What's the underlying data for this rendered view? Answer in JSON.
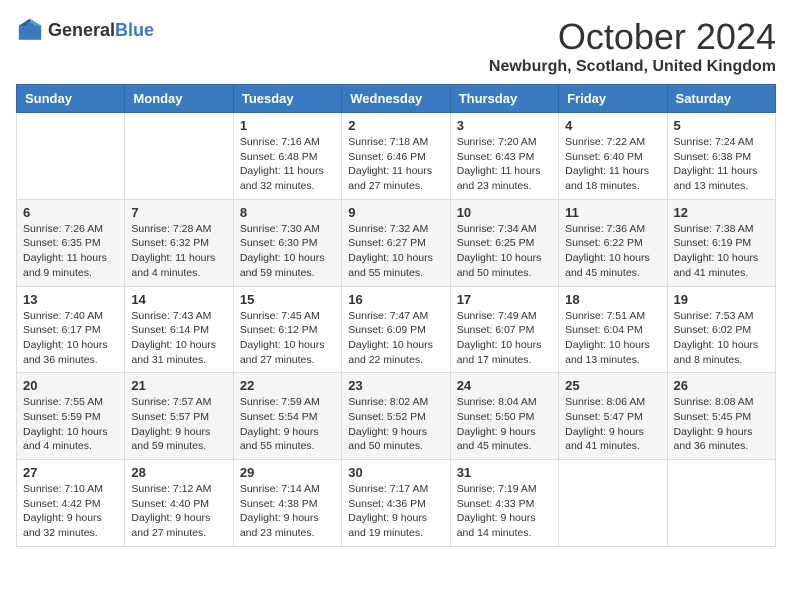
{
  "logo": {
    "text_general": "General",
    "text_blue": "Blue"
  },
  "header": {
    "month": "October 2024",
    "location": "Newburgh, Scotland, United Kingdom"
  },
  "days_of_week": [
    "Sunday",
    "Monday",
    "Tuesday",
    "Wednesday",
    "Thursday",
    "Friday",
    "Saturday"
  ],
  "weeks": [
    [
      {
        "day": "",
        "info": ""
      },
      {
        "day": "",
        "info": ""
      },
      {
        "day": "1",
        "info": "Sunrise: 7:16 AM\nSunset: 6:48 PM\nDaylight: 11 hours and 32 minutes."
      },
      {
        "day": "2",
        "info": "Sunrise: 7:18 AM\nSunset: 6:46 PM\nDaylight: 11 hours and 27 minutes."
      },
      {
        "day": "3",
        "info": "Sunrise: 7:20 AM\nSunset: 6:43 PM\nDaylight: 11 hours and 23 minutes."
      },
      {
        "day": "4",
        "info": "Sunrise: 7:22 AM\nSunset: 6:40 PM\nDaylight: 11 hours and 18 minutes."
      },
      {
        "day": "5",
        "info": "Sunrise: 7:24 AM\nSunset: 6:38 PM\nDaylight: 11 hours and 13 minutes."
      }
    ],
    [
      {
        "day": "6",
        "info": "Sunrise: 7:26 AM\nSunset: 6:35 PM\nDaylight: 11 hours and 9 minutes."
      },
      {
        "day": "7",
        "info": "Sunrise: 7:28 AM\nSunset: 6:32 PM\nDaylight: 11 hours and 4 minutes."
      },
      {
        "day": "8",
        "info": "Sunrise: 7:30 AM\nSunset: 6:30 PM\nDaylight: 10 hours and 59 minutes."
      },
      {
        "day": "9",
        "info": "Sunrise: 7:32 AM\nSunset: 6:27 PM\nDaylight: 10 hours and 55 minutes."
      },
      {
        "day": "10",
        "info": "Sunrise: 7:34 AM\nSunset: 6:25 PM\nDaylight: 10 hours and 50 minutes."
      },
      {
        "day": "11",
        "info": "Sunrise: 7:36 AM\nSunset: 6:22 PM\nDaylight: 10 hours and 45 minutes."
      },
      {
        "day": "12",
        "info": "Sunrise: 7:38 AM\nSunset: 6:19 PM\nDaylight: 10 hours and 41 minutes."
      }
    ],
    [
      {
        "day": "13",
        "info": "Sunrise: 7:40 AM\nSunset: 6:17 PM\nDaylight: 10 hours and 36 minutes."
      },
      {
        "day": "14",
        "info": "Sunrise: 7:43 AM\nSunset: 6:14 PM\nDaylight: 10 hours and 31 minutes."
      },
      {
        "day": "15",
        "info": "Sunrise: 7:45 AM\nSunset: 6:12 PM\nDaylight: 10 hours and 27 minutes."
      },
      {
        "day": "16",
        "info": "Sunrise: 7:47 AM\nSunset: 6:09 PM\nDaylight: 10 hours and 22 minutes."
      },
      {
        "day": "17",
        "info": "Sunrise: 7:49 AM\nSunset: 6:07 PM\nDaylight: 10 hours and 17 minutes."
      },
      {
        "day": "18",
        "info": "Sunrise: 7:51 AM\nSunset: 6:04 PM\nDaylight: 10 hours and 13 minutes."
      },
      {
        "day": "19",
        "info": "Sunrise: 7:53 AM\nSunset: 6:02 PM\nDaylight: 10 hours and 8 minutes."
      }
    ],
    [
      {
        "day": "20",
        "info": "Sunrise: 7:55 AM\nSunset: 5:59 PM\nDaylight: 10 hours and 4 minutes."
      },
      {
        "day": "21",
        "info": "Sunrise: 7:57 AM\nSunset: 5:57 PM\nDaylight: 9 hours and 59 minutes."
      },
      {
        "day": "22",
        "info": "Sunrise: 7:59 AM\nSunset: 5:54 PM\nDaylight: 9 hours and 55 minutes."
      },
      {
        "day": "23",
        "info": "Sunrise: 8:02 AM\nSunset: 5:52 PM\nDaylight: 9 hours and 50 minutes."
      },
      {
        "day": "24",
        "info": "Sunrise: 8:04 AM\nSunset: 5:50 PM\nDaylight: 9 hours and 45 minutes."
      },
      {
        "day": "25",
        "info": "Sunrise: 8:06 AM\nSunset: 5:47 PM\nDaylight: 9 hours and 41 minutes."
      },
      {
        "day": "26",
        "info": "Sunrise: 8:08 AM\nSunset: 5:45 PM\nDaylight: 9 hours and 36 minutes."
      }
    ],
    [
      {
        "day": "27",
        "info": "Sunrise: 7:10 AM\nSunset: 4:42 PM\nDaylight: 9 hours and 32 minutes."
      },
      {
        "day": "28",
        "info": "Sunrise: 7:12 AM\nSunset: 4:40 PM\nDaylight: 9 hours and 27 minutes."
      },
      {
        "day": "29",
        "info": "Sunrise: 7:14 AM\nSunset: 4:38 PM\nDaylight: 9 hours and 23 minutes."
      },
      {
        "day": "30",
        "info": "Sunrise: 7:17 AM\nSunset: 4:36 PM\nDaylight: 9 hours and 19 minutes."
      },
      {
        "day": "31",
        "info": "Sunrise: 7:19 AM\nSunset: 4:33 PM\nDaylight: 9 hours and 14 minutes."
      },
      {
        "day": "",
        "info": ""
      },
      {
        "day": "",
        "info": ""
      }
    ]
  ]
}
